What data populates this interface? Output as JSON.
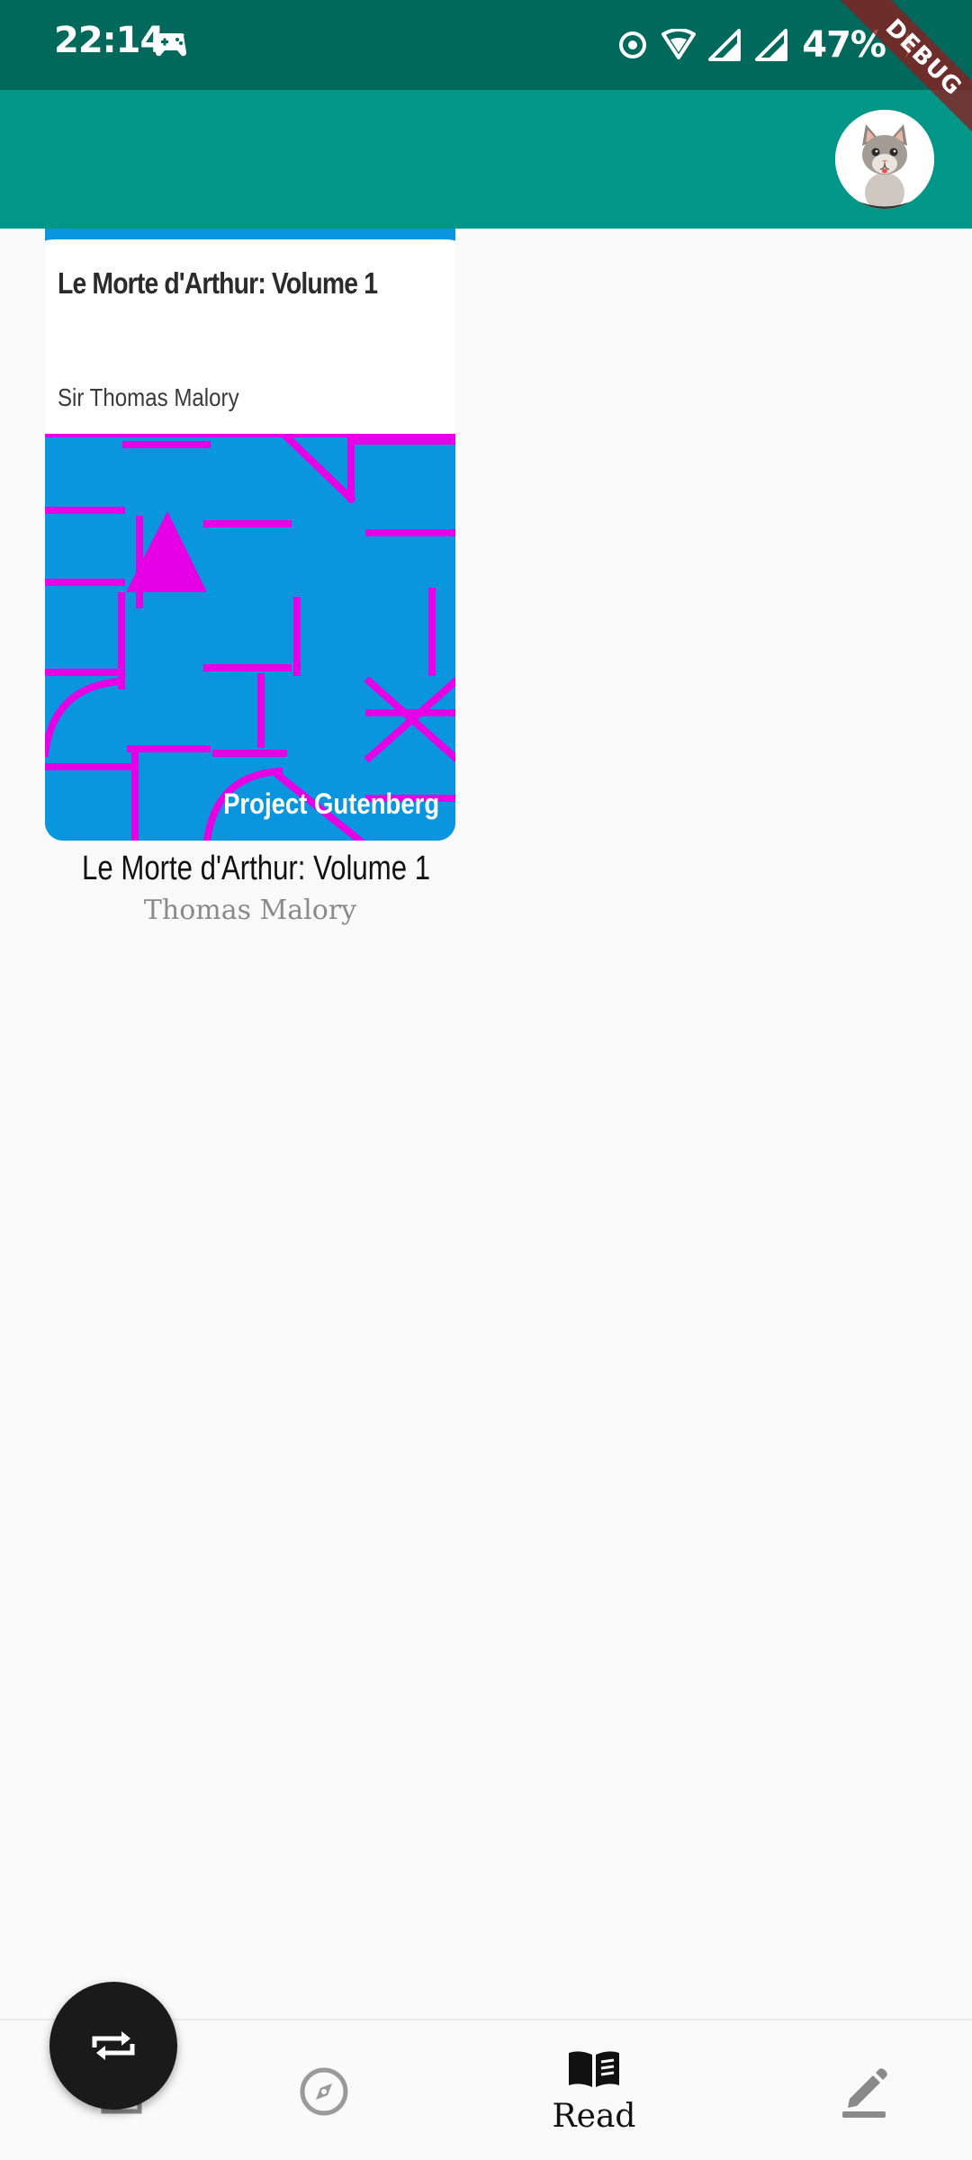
{
  "status_bar": {
    "time": "22:14",
    "battery": "47%",
    "icons": [
      "game-controller-icon",
      "data-saver-icon",
      "wifi-icon",
      "signal-icon",
      "signal-icon",
      "battery-charging-icon"
    ]
  },
  "debug_banner": "DEBUG",
  "app_bar": {
    "avatar_icon": "cat-avatar"
  },
  "book": {
    "cover_title": "Le Morte d'Arthur: Volume 1",
    "cover_author": "Sir Thomas Malory",
    "cover_publisher": "Project Gutenberg",
    "title": "Le Morte d'Arthur: Volume 1",
    "author": "Thomas Malory",
    "cover_colors": {
      "background": "#0a96de",
      "pattern": "#e600e6"
    }
  },
  "bottom_nav": {
    "items": [
      {
        "icon": "home-icon",
        "label": ""
      },
      {
        "icon": "compass-icon",
        "label": ""
      },
      {
        "icon": "open-book-icon",
        "label": "Read",
        "active": true
      },
      {
        "icon": "pencil-icon",
        "label": ""
      }
    ]
  },
  "fab": {
    "icon": "swap-icon"
  },
  "colors": {
    "status_bar": "#00695c",
    "app_bar": "#009688",
    "background": "#fafafa"
  }
}
